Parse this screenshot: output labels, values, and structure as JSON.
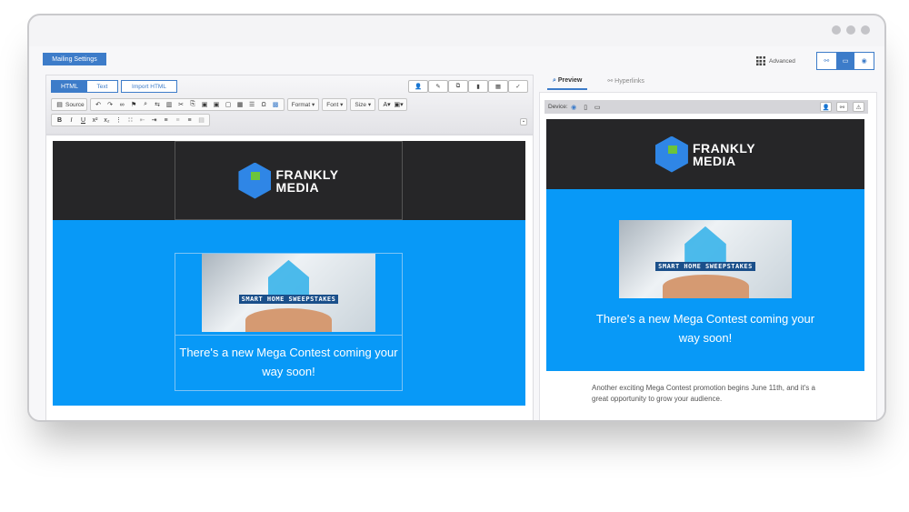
{
  "top": {
    "mailing_settings": "Mailing Settings",
    "advanced": "Advanced"
  },
  "editor": {
    "tabs": [
      "HTML",
      "Text"
    ],
    "import_html": "Import HTML",
    "source": "Source",
    "dropdowns": [
      "Format",
      "Font",
      "Size"
    ]
  },
  "email": {
    "brand_line1": "FRANKLY",
    "brand_line2": "MEDIA",
    "banner_text": "SMART HOME SWEEPSTAKES",
    "headline": "There's a new Mega Contest coming your way soon!",
    "body": "Another exciting Mega Contest promotion begins June 11th, and it's a great opportunity to grow your audience."
  },
  "preview": {
    "tabs": [
      "Preview",
      "Hyperlinks"
    ],
    "device_label": "Device:"
  },
  "colors": {
    "accent": "#3d7cc9",
    "email_blue": "#0899f7",
    "email_dark": "#262628"
  }
}
